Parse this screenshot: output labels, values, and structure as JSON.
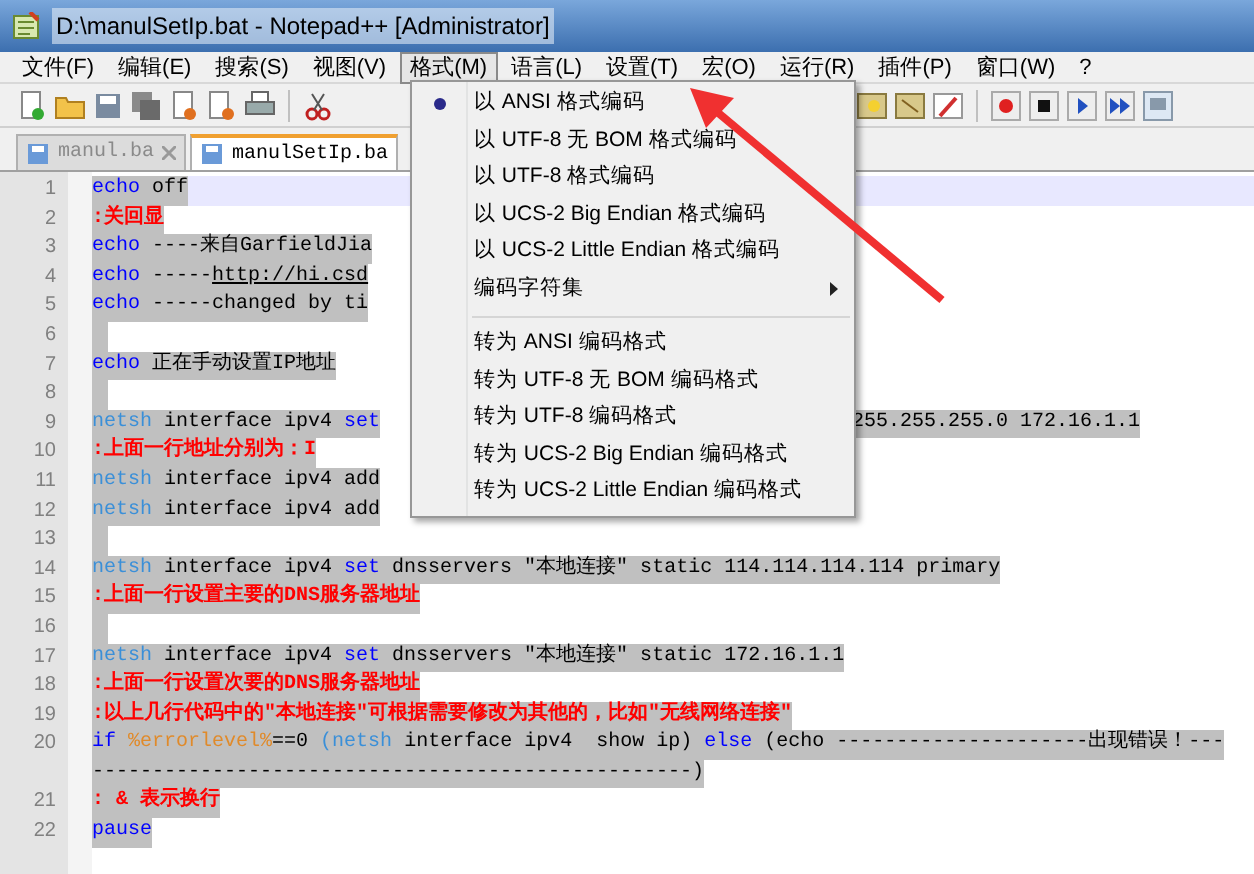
{
  "window": {
    "title": "D:\\manulSetIp.bat - Notepad++ [Administrator]"
  },
  "menu_bar": [
    {
      "label": "文件(F)",
      "selected": false
    },
    {
      "label": "编辑(E)",
      "selected": false
    },
    {
      "label": "搜索(S)",
      "selected": false
    },
    {
      "label": "视图(V)",
      "selected": false
    },
    {
      "label": "格式(M)",
      "selected": true
    },
    {
      "label": "语言(L)",
      "selected": false
    },
    {
      "label": "设置(T)",
      "selected": false
    },
    {
      "label": "宏(O)",
      "selected": false
    },
    {
      "label": "运行(R)",
      "selected": false
    },
    {
      "label": "插件(P)",
      "selected": false
    },
    {
      "label": "窗口(W)",
      "selected": false
    },
    {
      "label": "?",
      "selected": false
    }
  ],
  "tabs": [
    {
      "label": "manul.ba",
      "selected": false
    },
    {
      "label": "manulSetIp.ba",
      "selected": true
    }
  ],
  "format_menu": [
    {
      "kind": "item",
      "label": "以 ANSI 格式编码",
      "selected": true
    },
    {
      "kind": "item",
      "label": "以 UTF-8 无 BOM 格式编码",
      "selected": false
    },
    {
      "kind": "item",
      "label": "以 UTF-8 格式编码",
      "selected": false
    },
    {
      "kind": "item",
      "label": "以 UCS-2 Big Endian 格式编码",
      "selected": false
    },
    {
      "kind": "item",
      "label": "以 UCS-2 Little Endian 格式编码",
      "selected": false
    },
    {
      "kind": "submenu",
      "label": "编码字符集",
      "selected": false
    },
    {
      "kind": "separator"
    },
    {
      "kind": "item",
      "label": "转为 ANSI 编码格式",
      "selected": false
    },
    {
      "kind": "item",
      "label": "转为 UTF-8 无 BOM 编码格式",
      "selected": false
    },
    {
      "kind": "item",
      "label": "转为 UTF-8 编码格式",
      "selected": false
    },
    {
      "kind": "item",
      "label": "转为 UCS-2 Big Endian 编码格式",
      "selected": false
    },
    {
      "kind": "item",
      "label": "转为 UCS-2 Little Endian 编码格式",
      "selected": false
    }
  ],
  "editor": {
    "lines": [
      {
        "number": "1",
        "current": true,
        "segments": [
          {
            "kind": "keyword",
            "text": "echo"
          },
          {
            "kind": "plain",
            "text": " off"
          }
        ]
      },
      {
        "number": "2",
        "current": false,
        "segments": [
          {
            "kind": "comment",
            "text": ":关回显"
          }
        ]
      },
      {
        "number": "3",
        "current": false,
        "segments": [
          {
            "kind": "keyword",
            "text": "echo"
          },
          {
            "kind": "plain",
            "text": " ----来自GarfieldJia"
          }
        ]
      },
      {
        "number": "4",
        "current": false,
        "segments": [
          {
            "kind": "keyword",
            "text": "echo"
          },
          {
            "kind": "plain",
            "text": " -----"
          },
          {
            "kind": "link",
            "text": "http://hi.csd"
          }
        ]
      },
      {
        "number": "5",
        "current": false,
        "segments": [
          {
            "kind": "keyword",
            "text": "echo"
          },
          {
            "kind": "plain",
            "text": " -----changed by ti"
          }
        ]
      },
      {
        "number": "6",
        "current": false
      },
      {
        "number": "7",
        "current": false,
        "segments": [
          {
            "kind": "keyword",
            "text": "echo"
          },
          {
            "kind": "plain",
            "text": " 正在手动设置IP地址"
          }
        ]
      },
      {
        "number": "8",
        "current": false
      },
      {
        "number": "9",
        "current": false,
        "segments": [
          {
            "kind": "command",
            "text": "netsh"
          },
          {
            "kind": "plain",
            "text": " interface ipv4 "
          },
          {
            "kind": "keyword",
            "text": "set"
          }
        ],
        "tail": "255.255.255.0 172.16.1.1"
      },
      {
        "number": "10",
        "current": false,
        "segments": [
          {
            "kind": "comment",
            "text": ":上面一行地址分别为：I"
          }
        ]
      },
      {
        "number": "11",
        "current": false,
        "segments": [
          {
            "kind": "command",
            "text": "netsh"
          },
          {
            "kind": "plain",
            "text": " interface ipv4 add"
          }
        ]
      },
      {
        "number": "12",
        "current": false,
        "segments": [
          {
            "kind": "command",
            "text": "netsh"
          },
          {
            "kind": "plain",
            "text": " interface ipv4 add"
          }
        ]
      },
      {
        "number": "13",
        "current": false
      },
      {
        "number": "14",
        "current": false,
        "segments": [
          {
            "kind": "command",
            "text": "netsh"
          },
          {
            "kind": "plain",
            "text": " interface ipv4 "
          },
          {
            "kind": "keyword",
            "text": "set"
          },
          {
            "kind": "plain",
            "text": " dnsservers \"本地连接\" static 114.114.114.114 primary"
          }
        ]
      },
      {
        "number": "15",
        "current": false,
        "segments": [
          {
            "kind": "comment",
            "text": ":上面一行设置主要的DNS服务器地址"
          }
        ]
      },
      {
        "number": "16",
        "current": false
      },
      {
        "number": "17",
        "current": false,
        "segments": [
          {
            "kind": "command",
            "text": "netsh"
          },
          {
            "kind": "plain",
            "text": " interface ipv4 "
          },
          {
            "kind": "keyword",
            "text": "set"
          },
          {
            "kind": "plain",
            "text": " dnsservers \"本地连接\" static 172.16.1.1"
          }
        ]
      },
      {
        "number": "18",
        "current": false,
        "segments": [
          {
            "kind": "comment",
            "text": ":上面一行设置次要的DNS服务器地址"
          }
        ]
      },
      {
        "number": "19",
        "current": false,
        "segments": [
          {
            "kind": "comment",
            "text": ":以上几行代码中的\"本地连接\"可根据需要修改为其他的，比如\"无线网络连接\""
          }
        ]
      },
      {
        "number": "20",
        "current": false,
        "segments": [
          {
            "kind": "keyword",
            "text": "if "
          },
          {
            "kind": "variable",
            "text": "%errorlevel%"
          },
          {
            "kind": "plain",
            "text": "==0 "
          },
          {
            "kind": "command",
            "text": "(netsh"
          },
          {
            "kind": "plain",
            "text": " interface ipv4  show ip) "
          },
          {
            "kind": "keyword",
            "text": "else"
          },
          {
            "kind": "plain",
            "text": " (echo ---------------------出现错误！---"
          }
        ],
        "wrap": "--------------------------------------------------)"
      },
      {
        "number": "21",
        "current": false,
        "segments": [
          {
            "kind": "comment",
            "text": ": & 表示换行"
          }
        ]
      },
      {
        "number": "22",
        "current": false,
        "segments": [
          {
            "kind": "keyword",
            "text": "pause"
          }
        ]
      }
    ]
  }
}
